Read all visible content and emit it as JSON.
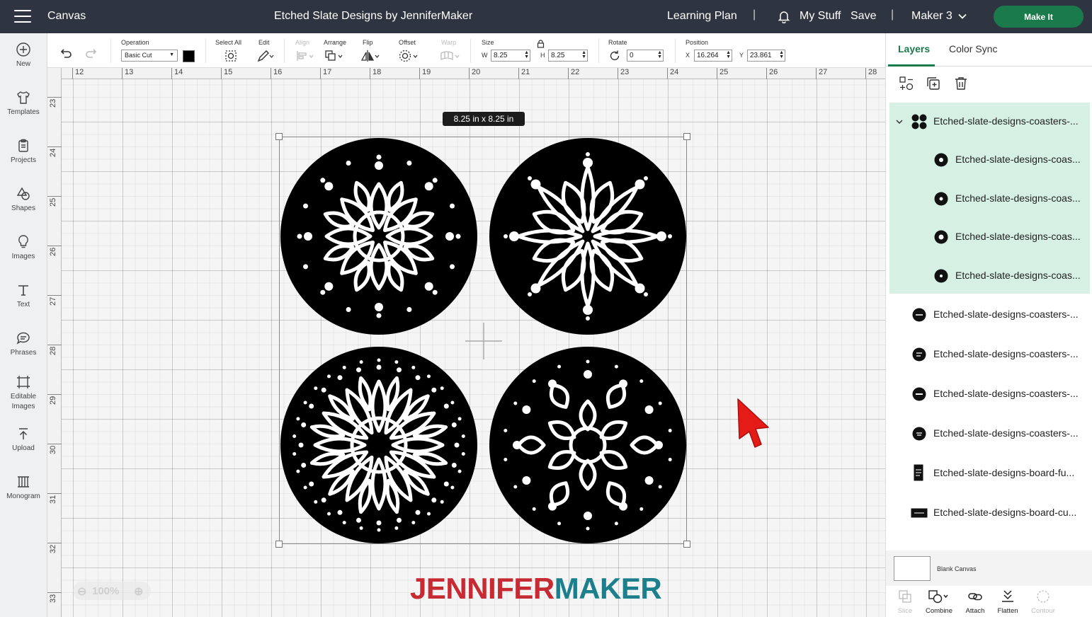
{
  "topbar": {
    "app_title": "Canvas",
    "doc_title": "Etched Slate Designs by JenniferMaker",
    "learning_plan": "Learning Plan",
    "my_stuff": "My Stuff",
    "save": "Save",
    "machine": "Maker 3",
    "make_it": "Make It",
    "separator": "|"
  },
  "sidebar": {
    "items": [
      {
        "label": "New",
        "icon": "plus-circle-icon"
      },
      {
        "label": "Templates",
        "icon": "tshirt-icon"
      },
      {
        "label": "Projects",
        "icon": "clipboard-icon"
      },
      {
        "label": "Shapes",
        "icon": "shapes-icon"
      },
      {
        "label": "Images",
        "icon": "lightbulb-icon"
      },
      {
        "label": "Text",
        "icon": "text-icon"
      },
      {
        "label": "Phrases",
        "icon": "speech-bubble-icon"
      },
      {
        "label": "Editable",
        "label2": "Images",
        "icon": "editable-images-icon"
      },
      {
        "label": "Upload",
        "icon": "upload-icon"
      },
      {
        "label": "Monogram",
        "icon": "monogram-icon"
      }
    ]
  },
  "toolbar": {
    "operation_label": "Operation",
    "operation_value": "Basic Cut",
    "operation_color": "#000000",
    "select_all_label": "Select All",
    "edit_label": "Edit",
    "align_label": "Align",
    "arrange_label": "Arrange",
    "flip_label": "Flip",
    "offset_label": "Offset",
    "warp_label": "Warp",
    "size_label": "Size",
    "width_prefix": "W",
    "width_value": "8.25",
    "height_prefix": "H",
    "height_value": "8.25",
    "rotate_label": "Rotate",
    "rotate_value": "0",
    "position_label": "Position",
    "x_prefix": "X",
    "x_value": "16.264",
    "y_prefix": "Y",
    "y_value": "23.861"
  },
  "canvas": {
    "ruler_top": [
      "12",
      "13",
      "14",
      "15",
      "16",
      "17",
      "18",
      "19",
      "20",
      "21",
      "22",
      "23",
      "24",
      "25",
      "26",
      "27",
      "28"
    ],
    "ruler_left": [
      "23",
      "24",
      "25",
      "26",
      "27",
      "28",
      "29",
      "30",
      "31",
      "32",
      "33"
    ],
    "size_badge": "8.25  in x 8.25  in",
    "zoom": "100%",
    "watermark_part1": "JENNIFER",
    "watermark_part2": "MAKER",
    "brand_red": "#c62a32",
    "brand_teal": "#1e7f8c"
  },
  "layers_panel": {
    "tab_layers": "Layers",
    "tab_color_sync": "Color Sync",
    "group": {
      "name": "Etched-slate-designs-coasters-...",
      "children": [
        "Etched-slate-designs-coas...",
        "Etched-slate-designs-coas...",
        "Etched-slate-designs-coas...",
        "Etched-slate-designs-coas..."
      ]
    },
    "layers": [
      "Etched-slate-designs-coasters-...",
      "Etched-slate-designs-coasters-...",
      "Etched-slate-designs-coasters-...",
      "Etched-slate-designs-coasters-...",
      "Etched-slate-designs-board-fu...",
      "Etched-slate-designs-board-cu..."
    ],
    "blank_canvas": "Blank Canvas",
    "tools": {
      "slice": "Slice",
      "combine": "Combine",
      "attach": "Attach",
      "flatten": "Flatten",
      "contour": "Contour"
    },
    "accent": "#1a7a4c",
    "group_highlight": "#d6f1e4"
  }
}
